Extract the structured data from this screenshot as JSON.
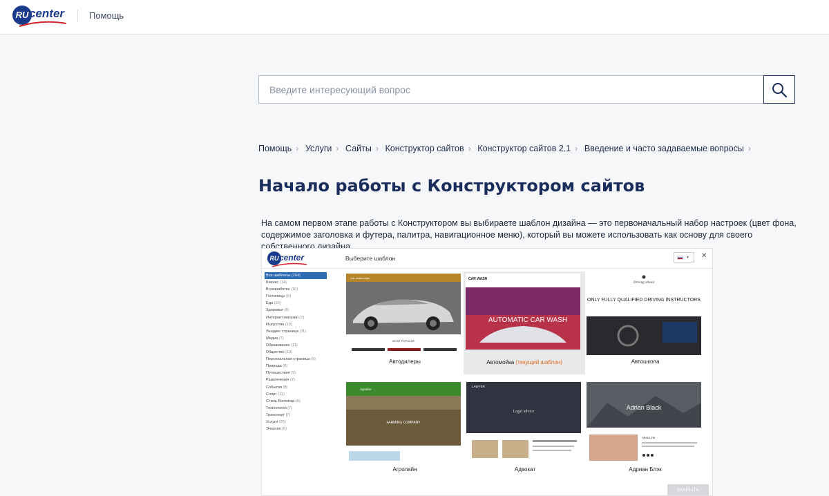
{
  "header": {
    "logo": {
      "ru": "RU",
      "center": "center"
    },
    "help_link": "Помощь"
  },
  "search": {
    "placeholder": "Введите интересующий вопрос",
    "value": ""
  },
  "breadcrumb": [
    "Помощь",
    "Услуги",
    "Сайты",
    "Конструктор сайтов",
    "Конструктор сайтов 2.1",
    "Введение и часто задаваемые вопросы"
  ],
  "page_title": "Начало работы с Конструктором сайтов",
  "intro_text": "На самом первом этапе работы с Конструктором вы выбираете шаблон дизайна — это первоначальный набор настроек (цвет фона, содержимое заголовка и футера, палитра, навигационное меню), который вы можете использовать как основу для своего собственного дизайна.",
  "screenshot": {
    "logo": {
      "ru": "RU",
      "center": "center"
    },
    "title": "Выберите шаблон",
    "close_glyph": "✕",
    "categories": [
      {
        "name": "Все шаблоны",
        "count": "(204)",
        "active": true
      },
      {
        "name": "Бизнес",
        "count": "(14)"
      },
      {
        "name": "В разработке",
        "count": "(10)"
      },
      {
        "name": "Гостиницы",
        "count": "(6)"
      },
      {
        "name": "Еда",
        "count": "(10)"
      },
      {
        "name": "Здоровье",
        "count": "(8)"
      },
      {
        "name": "Интернет-магазин",
        "count": "(7)"
      },
      {
        "name": "Искусство",
        "count": "(10)"
      },
      {
        "name": "Лендинг страница",
        "count": "(11)"
      },
      {
        "name": "Медиа",
        "count": "(7)"
      },
      {
        "name": "Образование",
        "count": "(11)"
      },
      {
        "name": "Общество",
        "count": "(10)"
      },
      {
        "name": "Персональная страница",
        "count": "(9)"
      },
      {
        "name": "Природа",
        "count": "(6)"
      },
      {
        "name": "Путешествия",
        "count": "(9)"
      },
      {
        "name": "Развлечения",
        "count": "(7)"
      },
      {
        "name": "События",
        "count": "(8)"
      },
      {
        "name": "Спорт",
        "count": "(11)"
      },
      {
        "name": "Стиль Bootstrap",
        "count": "(5)"
      },
      {
        "name": "Технологии",
        "count": "(7)"
      },
      {
        "name": "Транспорт",
        "count": "(7)"
      },
      {
        "name": "Услуги",
        "count": "(25)"
      },
      {
        "name": "Энергия",
        "count": "(6)"
      }
    ],
    "templates": [
      {
        "label": "Автодилеры",
        "thumb_text": "MOST POPULAR",
        "thumb_header": "Car dealerships"
      },
      {
        "label": "Автомойка",
        "current_suffix": "(текущий шаблон)",
        "thumb_text": "AUTOMATIC CAR WASH",
        "thumb_header": "CAR WASH"
      },
      {
        "label": "Автошкола",
        "thumb_text": "ONLY FULLY QUALIFIED DRIVING INSTRUCTORS",
        "thumb_header": "Driving school"
      },
      {
        "label": "Агролайн",
        "thumb_text": "FARMING COMPANY",
        "thumb_header": "Agroline"
      },
      {
        "label": "Адвокат",
        "thumb_text": "Legal advice",
        "thumb_header": "LAWYER"
      },
      {
        "label": "Адриан Блэк",
        "thumb_text": "Adrian Black",
        "thumb_header": "About me"
      }
    ],
    "close_button": "ЗАКРЫТЬ"
  },
  "colors": {
    "brand_blue": "#1a3a8c",
    "title_navy": "#1a2c5b",
    "brand_red": "#d3222a",
    "current_orange": "#e86a1d"
  }
}
